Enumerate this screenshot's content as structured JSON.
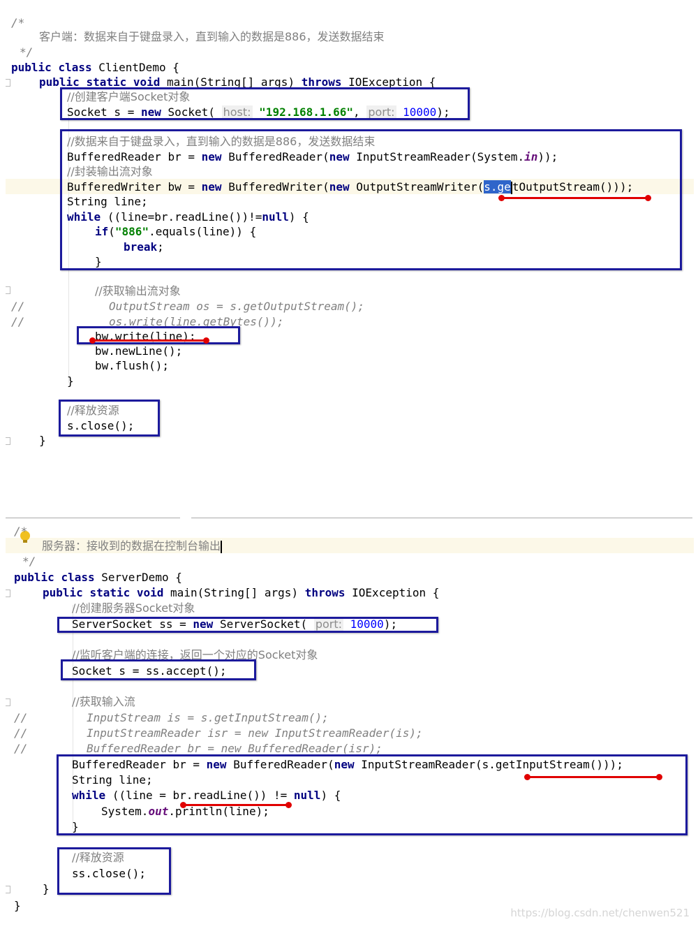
{
  "client": {
    "comment_open": "/*",
    "comment_desc": "客户端：数据来自于键盘录入，直到输入的数据是886，发送数据结束",
    "comment_close": "*/",
    "kw_public": "public",
    "kw_class": "class",
    "class_name": "ClientDemo {",
    "main_public": "public",
    "main_static": "static",
    "main_void": "void",
    "main_sig": "main(String[] args)",
    "main_throws": "throws",
    "main_exc": "IOException {",
    "c_create_socket": "//创建客户端Socket对象",
    "socket_decl": "Socket s = ",
    "kw_new": "new",
    "socket_ctor": "Socket(",
    "hint_host": "host:",
    "host_value": "\"192.168.1.66\"",
    "comma": ",",
    "hint_port": "port:",
    "port_value": "10000",
    "close_paren": ");",
    "c_keyboard": "//数据来自于键盘录入，直到输入的数据是886，发送数据结束",
    "br_decl": "BufferedReader br = ",
    "br_ctor": "BufferedReader(",
    "br_isr": "InputStreamReader(System.",
    "system_in": "in",
    "br_end": "));",
    "c_wrap": "//封装输出流对象",
    "bw_decl": "BufferedWriter bw = ",
    "bw_ctor": "BufferedWriter(",
    "bw_osw": "OutputStreamWriter(",
    "sel_text": "s.ge",
    "bw_rest": "tOutputStream()));",
    "string_line": "String line;",
    "kw_while": "while",
    "while_cond": "((line=br.readLine())!=",
    "kw_null": "null",
    "while_end": ") {",
    "kw_if": "if",
    "if_open": "(",
    "str_886": "\"886\"",
    "if_rest": ".equals(line)) {",
    "kw_break": "break",
    "semicolon": ";",
    "brace_close": "}",
    "c_get_out": "//获取输出流对象",
    "slashes1": "//",
    "c_os_decl": "OutputStream os = s.getOutputStream();",
    "slashes2": "//",
    "c_os_write": "os.write(line.getBytes());",
    "bw_write": "bw.write(line);",
    "bw_newline": "bw.newLine();",
    "bw_flush": "bw.flush();",
    "c_release": "//释放资源",
    "s_close": "s.close();"
  },
  "server": {
    "comment_open": "/*",
    "comment_desc": "服务器：接收到的数据在控制台输出",
    "comment_close": "*/",
    "kw_public": "public",
    "kw_class": "class",
    "class_name": "ServerDemo {",
    "main_public": "public",
    "main_static": "static",
    "main_void": "void",
    "main_sig": "main(String[] args)",
    "main_throws": "throws",
    "main_exc": "IOException {",
    "c_create_ss": "//创建服务器Socket对象",
    "ss_decl": "ServerSocket ss = ",
    "kw_new": "new",
    "ss_ctor": "ServerSocket(",
    "hint_port": "port:",
    "port_value": "10000",
    "close_paren": ");",
    "c_listen": "//监听客户端的连接，返回一个对应的Socket对象",
    "accept_line": "Socket s = ss.accept();",
    "c_get_in": "//获取输入流",
    "slashes1": "//",
    "c_is": "InputStream is = s.getInputStream();",
    "slashes2": "//",
    "c_isr": "InputStreamReader isr = new InputStreamReader(is);",
    "slashes3": "//",
    "c_br": "BufferedReader br = new BufferedReader(isr);",
    "br_decl": "BufferedReader br = ",
    "br_ctor": "BufferedReader(",
    "br_isr": "InputStreamReader(s.getInputStream()));",
    "string_line": "String line;",
    "kw_while": "while",
    "while_cond": "((line = br.readLine()) != ",
    "kw_null": "null",
    "while_end": ") {",
    "println_pre": "System.",
    "system_out": "out",
    "println_post": ".println(line);",
    "brace_close": "}",
    "c_release": "//释放资源",
    "ss_close": "ss.close();",
    "method_close": "}",
    "class_close": "}"
  },
  "watermark": "https://blog.csdn.net/chenwen521",
  "colors": {
    "keyword": "#000080",
    "string": "#008000",
    "number": "#0000ff",
    "comment": "#808080",
    "annotation_box": "#1c1a9c",
    "annotation_line": "#e00000",
    "selection": "#2f65ca"
  }
}
